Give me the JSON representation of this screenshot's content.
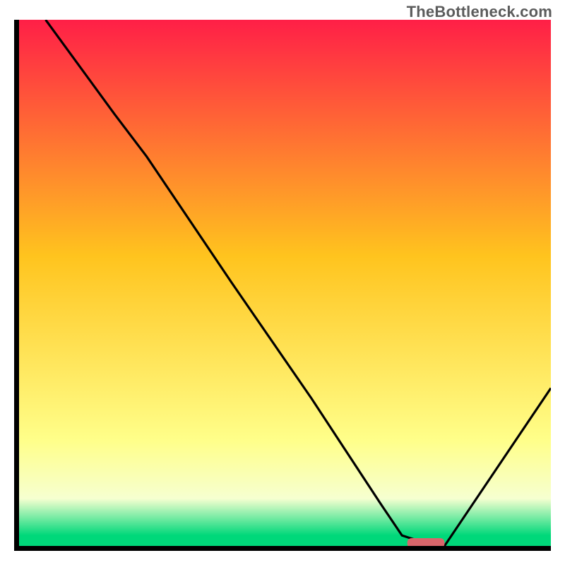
{
  "watermark": "TheBottleneck.com",
  "colors": {
    "gradient_top": "#ff1f47",
    "gradient_mid": "#ffc41e",
    "gradient_low": "#ffff8a",
    "gradient_bottom": "#00d87a",
    "curve": "#000000",
    "axis": "#000000",
    "marker": "#d9666b"
  },
  "chart_data": {
    "type": "line",
    "title": "",
    "xlabel": "",
    "ylabel": "",
    "xlim": [
      0,
      100
    ],
    "ylim": [
      0,
      100
    ],
    "series": [
      {
        "name": "curve",
        "x": [
          5,
          18,
          24,
          40,
          55,
          68,
          72,
          78,
          80,
          100
        ],
        "y": [
          100,
          82,
          74,
          50,
          28,
          8,
          2,
          0,
          0,
          30
        ]
      }
    ],
    "marker": {
      "x_start": 73,
      "x_end": 80,
      "y": 0
    },
    "gradient_stops": [
      {
        "pos": 0.0,
        "label": "top-red"
      },
      {
        "pos": 0.45,
        "label": "orange"
      },
      {
        "pos": 0.8,
        "label": "yellow"
      },
      {
        "pos": 0.98,
        "label": "green"
      }
    ]
  }
}
